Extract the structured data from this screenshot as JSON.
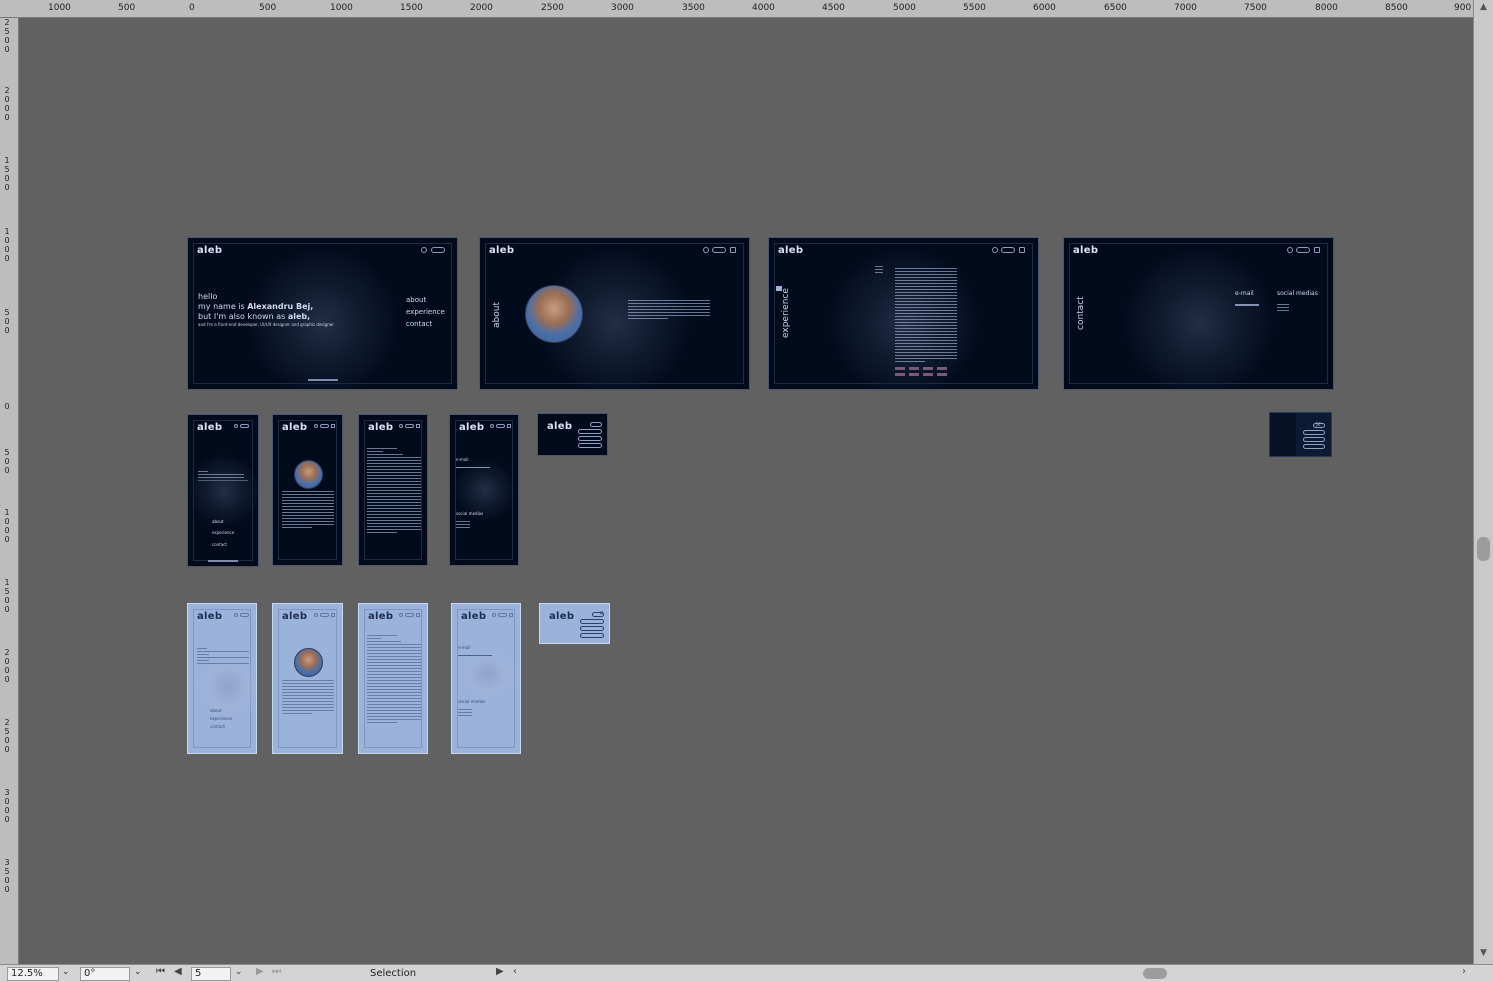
{
  "ruler": {
    "top_labels": [
      "1000",
      "500",
      "0",
      "500",
      "1000",
      "1500",
      "2000",
      "2500",
      "3000",
      "3500",
      "4000",
      "4500",
      "5000",
      "5500",
      "6000",
      "6500",
      "7000",
      "7500",
      "8000",
      "8500",
      "900"
    ],
    "left_labels": [
      "2\n5\n0\n0",
      "2\n0\n0\n0",
      "1\n5\n0\n0",
      "1\n0\n0\n0",
      "5\n0\n0",
      "0",
      "5\n0\n0",
      "1\n0\n0\n0",
      "1\n5\n0\n0",
      "2\n0\n0\n0",
      "2\n5\n0\n0",
      "3\n0\n0\n0",
      "3\n5\n0\n0"
    ]
  },
  "statusbar": {
    "zoom": "12.5%",
    "rotation": "0°",
    "page": "5",
    "mode": "Selection"
  },
  "brand": "aleb",
  "hero": {
    "line1": "hello",
    "line2_prefix": "my name is ",
    "line2_name": "Alexandru Bej,",
    "line3_prefix": "but I'm also known as ",
    "line3_nick": "aleb,",
    "line4": "and I'm a front-end developer, UI/UX designer and graphic designer",
    "nav": [
      "about",
      "experience",
      "contact"
    ]
  },
  "about_title": "about",
  "experience_title": "experience",
  "contact": {
    "title": "contact",
    "email_label": "e-mail",
    "social_label": "social medias"
  },
  "mobile_hero": {
    "nav": [
      "about",
      "experience",
      "contact"
    ]
  },
  "mobile_contact": {
    "email_label": "e-mail",
    "social_label": "social medias"
  }
}
